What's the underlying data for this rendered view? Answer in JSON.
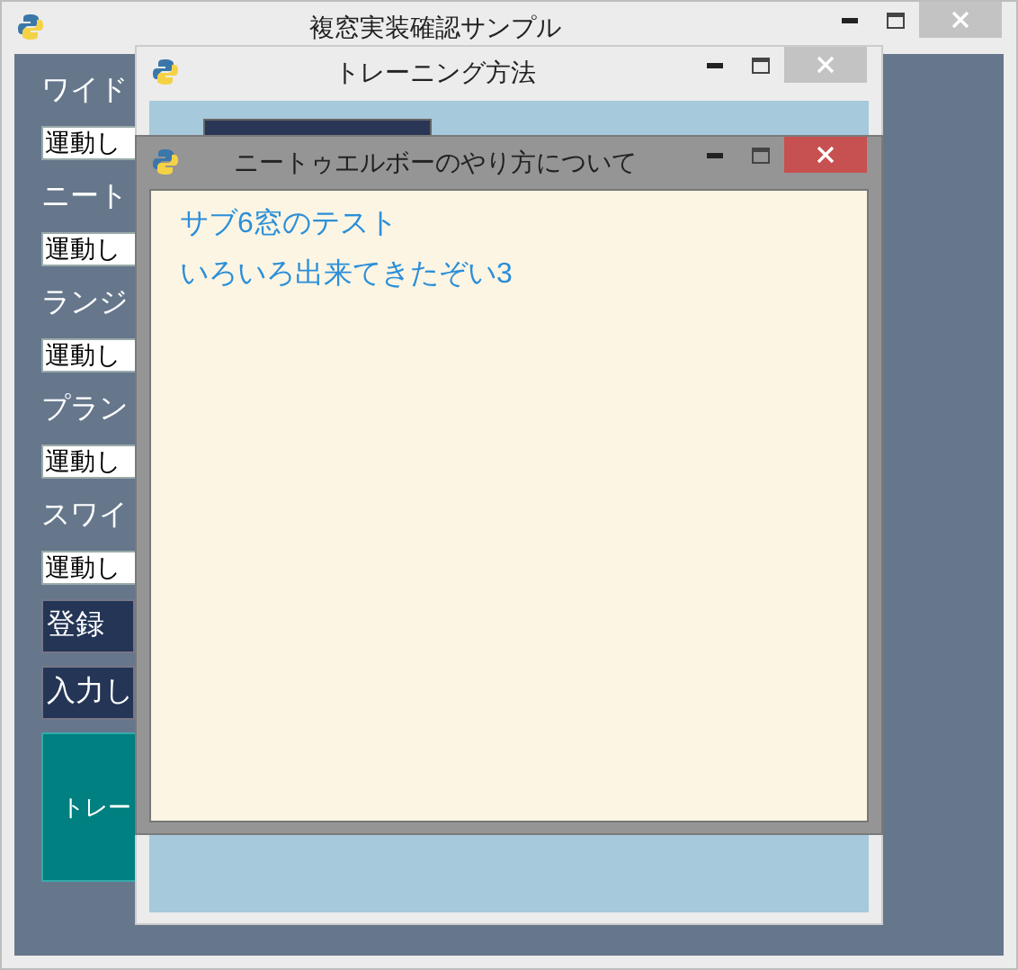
{
  "main_window": {
    "title": "複窓実装確認サンプル",
    "active": false,
    "fields": [
      {
        "label": "ワイド",
        "value": "運動し"
      },
      {
        "label": "ニート",
        "value": "運動し"
      },
      {
        "label": "ランジ",
        "value": "運動し"
      },
      {
        "label": "プラン",
        "value": "運動し"
      },
      {
        "label": "スワイ",
        "value": "運動し"
      }
    ],
    "buttons": [
      "登録",
      "入力し"
    ],
    "tile_button": "トレー"
  },
  "training_window": {
    "title": "トレーニング方法",
    "active": false
  },
  "detail_window": {
    "title": "ニートゥエルボーのやり方について",
    "active": true,
    "lines": [
      "サブ6窓のテスト",
      "いろいろ出来てきたぞい3"
    ]
  }
}
